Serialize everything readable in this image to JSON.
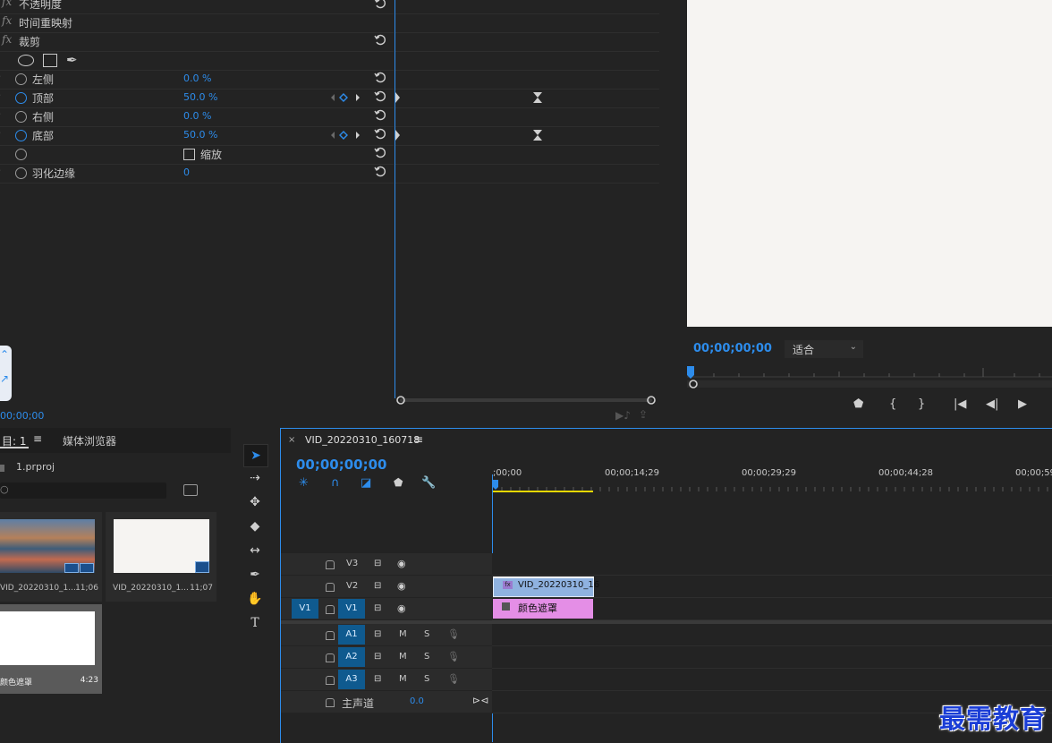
{
  "effects": {
    "rows": [
      {
        "fx": "fx",
        "name": "不透明度"
      },
      {
        "fx": "fx",
        "name": "时间重映射"
      },
      {
        "fx": "fx",
        "name": "裁剪"
      }
    ],
    "props": [
      {
        "name": "左侧",
        "value": "0.0 %",
        "animated": false
      },
      {
        "name": "顶部",
        "value": "50.0 %",
        "animated": true
      },
      {
        "name": "右侧",
        "value": "0.0 %",
        "animated": false
      },
      {
        "name": "底部",
        "value": "50.0 %",
        "animated": true
      },
      {
        "name": "",
        "value": "缩放",
        "animated": false
      },
      {
        "name": "羽化边缘",
        "value": "0",
        "animated": false
      }
    ],
    "footer_timecode": "00;00;00"
  },
  "program": {
    "timecode": "00;00;00;00",
    "fit_label": "适合"
  },
  "project": {
    "tab_project": "目: 1",
    "tab_media_browser": "媒体浏览器",
    "project_file": "1.prproj",
    "search_placeholder": "",
    "items": [
      {
        "name": "VID_20220310_1...",
        "duration": "11;06"
      },
      {
        "name": "VID_20220310_1...",
        "duration": "11;07"
      },
      {
        "name": "颜色遮罩",
        "duration": "4:23"
      }
    ]
  },
  "timeline": {
    "sequence_name": "VID_20220310_160718",
    "timecode": "00;00;00;00",
    "ruler_labels": [
      ";00;00",
      "00;00;14;29",
      "00;00;29;29",
      "00;00;44;28",
      "00;00;59"
    ],
    "video_tracks": [
      "V3",
      "V2",
      "V1"
    ],
    "source_patch": "V1",
    "audio_tracks": [
      "A1",
      "A2",
      "A3"
    ],
    "mute_label": "M",
    "solo_label": "S",
    "master_label": "主声道",
    "master_value": "0.0",
    "clip_video": "VID_20220310_16",
    "clip_matte": "颜色遮罩",
    "clip_video_color": "#8fb2e0",
    "clip_matte_color": "#e48ee6"
  },
  "watermark": "最需教育"
}
